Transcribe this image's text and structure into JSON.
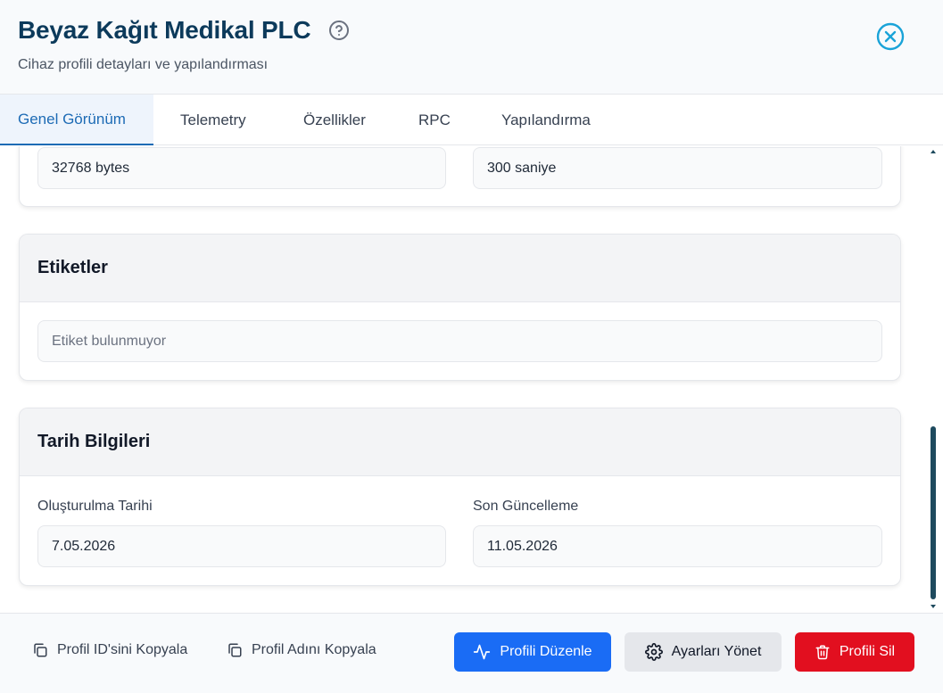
{
  "header": {
    "title": "Beyaz Kağıt Medikal PLC",
    "subtitle": "Cihaz profili detayları ve yapılandırması"
  },
  "tabs": [
    {
      "label": "Genel Görünüm",
      "active": true
    },
    {
      "label": "Telemetry",
      "active": false
    },
    {
      "label": "Özellikler",
      "active": false
    },
    {
      "label": "RPC",
      "active": false
    },
    {
      "label": "Yapılandırma",
      "active": false
    }
  ],
  "config_card": {
    "left_value": "32768 bytes",
    "right_value": "300 saniye"
  },
  "tags_card": {
    "title": "Etiketler",
    "empty_text": "Etiket bulunmuyor"
  },
  "dates_card": {
    "title": "Tarih Bilgileri",
    "created_label": "Oluşturulma Tarihi",
    "created_value": "7.05.2026",
    "updated_label": "Son Güncelleme",
    "updated_value": "11.05.2026"
  },
  "footer": {
    "copy_id_label": "Profil ID'sini Kopyala",
    "copy_name_label": "Profil Adını Kopyala",
    "edit_label": "Profili Düzenle",
    "manage_label": "Ayarları Yönet",
    "delete_label": "Profili Sil"
  },
  "colors": {
    "title": "#0c3a5b",
    "accent_tab": "#1d6bb5",
    "close_icon": "#1aa3d8",
    "primary": "#1a6cf5",
    "danger": "#e20f1f",
    "scroll_thumb": "#1e4a5e"
  },
  "icons": {
    "help": "question-circle-icon",
    "close": "close-circle-icon",
    "copy": "copy-icon",
    "edit": "activity-icon",
    "settings": "gear-icon",
    "delete": "trash-icon"
  }
}
